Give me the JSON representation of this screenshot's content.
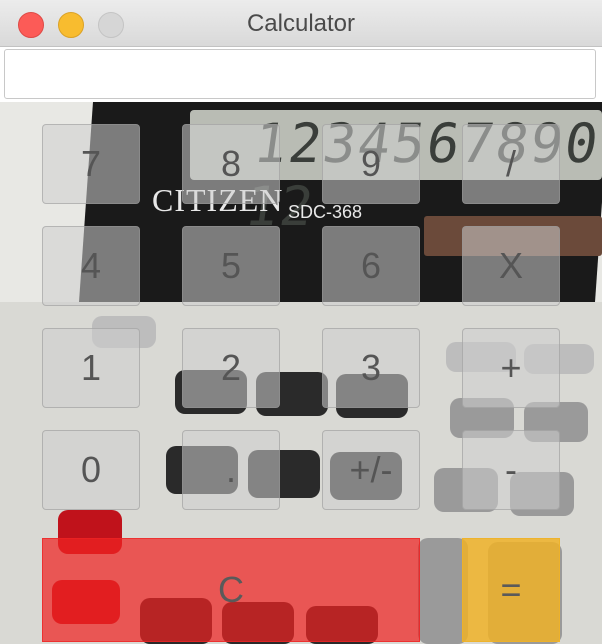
{
  "window": {
    "title": "Calculator"
  },
  "display": {
    "value": ""
  },
  "keypad": {
    "rows": [
      [
        "7",
        "8",
        "9",
        "/"
      ],
      [
        "4",
        "5",
        "6",
        "X"
      ],
      [
        "1",
        "2",
        "3",
        "+"
      ],
      [
        "0",
        ".",
        "+/-",
        "-"
      ]
    ],
    "clear": "C",
    "equals": "="
  },
  "background_photo": {
    "lcd_text": "1234567890 12",
    "brand": "CITIZEN",
    "model": "SDC-368"
  },
  "colors": {
    "clear_button": "#ee2323",
    "equals_button": "#eeb228",
    "close_light": "#fc5b57",
    "minimize_light": "#f8bc2f"
  }
}
